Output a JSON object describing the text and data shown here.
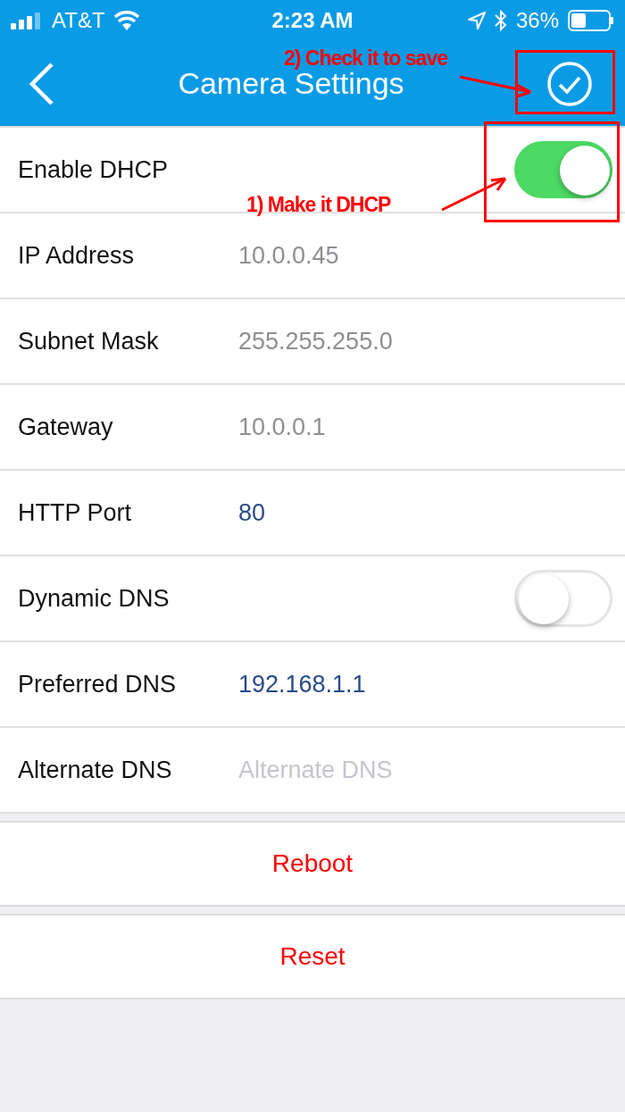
{
  "status_bar": {
    "carrier": "AT&T",
    "time": "2:23 AM",
    "battery": "36%"
  },
  "nav_bar": {
    "title": "Camera Settings"
  },
  "rows": [
    {
      "kind": "switch",
      "label": "Enable DHCP",
      "on": true
    },
    {
      "kind": "field",
      "label": "IP Address",
      "value": "10.0.0.45",
      "disabled": true
    },
    {
      "kind": "field",
      "label": "Subnet Mask",
      "value": "255.255.255.0",
      "disabled": true
    },
    {
      "kind": "field",
      "label": "Gateway",
      "value": "10.0.0.1",
      "disabled": true
    },
    {
      "kind": "field",
      "label": "HTTP Port",
      "value": "80",
      "disabled": false
    },
    {
      "kind": "switch",
      "label": "Dynamic DNS",
      "on": false
    },
    {
      "kind": "field",
      "label": "Preferred DNS",
      "value": "192.168.1.1",
      "disabled": false
    },
    {
      "kind": "field",
      "label": "Alternate DNS",
      "placeholder": "Alternate DNS"
    }
  ],
  "actions": [
    "Reboot",
    "Reset"
  ],
  "annotations": [
    {
      "text": "2) Check it to save"
    },
    {
      "text": "1) Make it DHCP"
    }
  ]
}
